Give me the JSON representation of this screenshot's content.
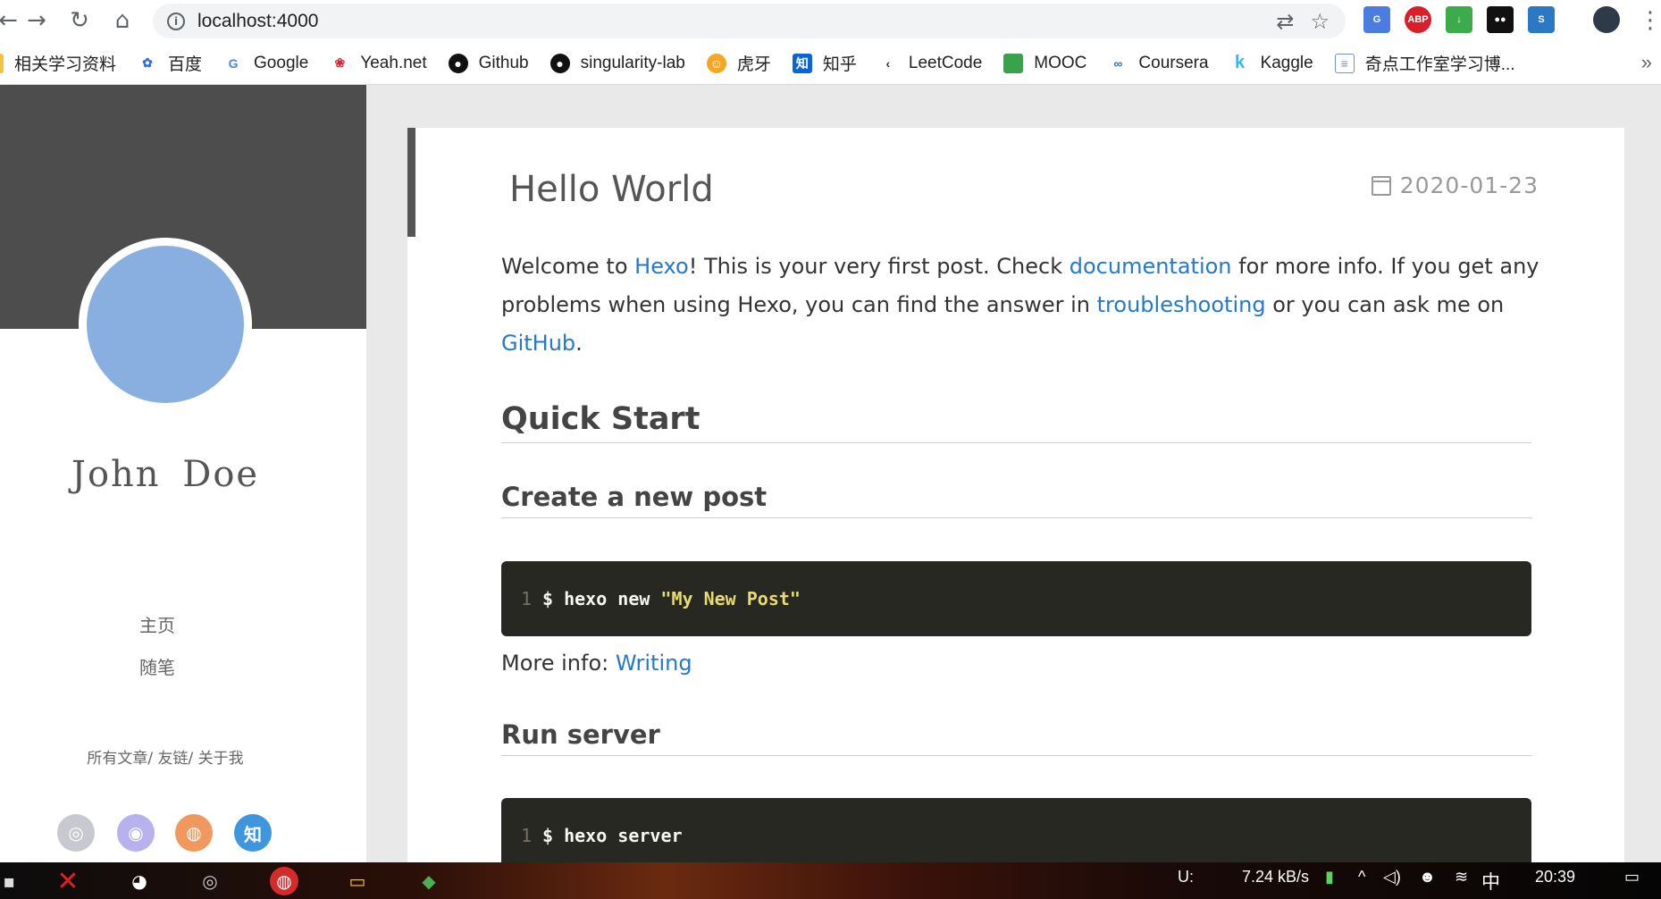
{
  "browser": {
    "url": "localhost:4000",
    "bookmarks": [
      {
        "label": "相关学习资料",
        "icon": "folder-icon"
      },
      {
        "label": "百度",
        "icon": "baidu-icon"
      },
      {
        "label": "Google",
        "icon": "google-icon"
      },
      {
        "label": "Yeah.net",
        "icon": "yeahnet-icon"
      },
      {
        "label": "Github",
        "icon": "github-icon"
      },
      {
        "label": "singularity-lab",
        "icon": "github-icon"
      },
      {
        "label": "虎牙",
        "icon": "huya-icon"
      },
      {
        "label": "知乎",
        "icon": "zhihu-icon"
      },
      {
        "label": "LeetCode",
        "icon": "leetcode-icon"
      },
      {
        "label": "MOOC",
        "icon": "mooc-icon"
      },
      {
        "label": "Coursera",
        "icon": "coursera-icon"
      },
      {
        "label": "Kaggle",
        "icon": "kaggle-icon"
      },
      {
        "label": "奇点工作室学习博...",
        "icon": "blog-icon"
      }
    ],
    "more_bookmarks": "»"
  },
  "sidebar": {
    "author": "John Doe",
    "menu": [
      "主页",
      "随笔"
    ],
    "links": {
      "all": "所有文章",
      "friends": "友链",
      "about": "关于我",
      "sep": "/"
    },
    "social": [
      {
        "name": "github-icon",
        "glyph": "◎",
        "color": "#c8c8d0"
      },
      {
        "name": "weibo-icon",
        "glyph": "◉",
        "color": "#b7b2ee"
      },
      {
        "name": "rss-icon",
        "glyph": "◍",
        "color": "#f0985d"
      },
      {
        "name": "zhihu-icon",
        "glyph": "知",
        "color": "#3f96dd"
      }
    ]
  },
  "post": {
    "title": "Hello World",
    "date": "2020-01-23",
    "intro": {
      "p1": "Welcome to ",
      "hexo": "Hexo",
      "p2": "! This is your very first post. Check ",
      "documentation": "documentation",
      "p3": " for more info. If you get any problems when using Hexo, you can find the answer in ",
      "troubleshooting": "troubleshooting",
      "p4": " or you can ask me on ",
      "github": "GitHub",
      "p5": "."
    },
    "h_quick_start": "Quick Start",
    "h_create": "Create a new post",
    "code1": {
      "line": "1",
      "cmd": "$ hexo new",
      "arg": "\"My New Post\""
    },
    "more_info_label": "More info: ",
    "more_info_link": "Writing",
    "h_run": "Run server",
    "code2": {
      "line": "1",
      "cmd": "$ hexo server"
    }
  },
  "taskbar": {
    "drive": "U:",
    "speed": "7.24 kB/s",
    "ime": "中",
    "time": "20:39"
  }
}
